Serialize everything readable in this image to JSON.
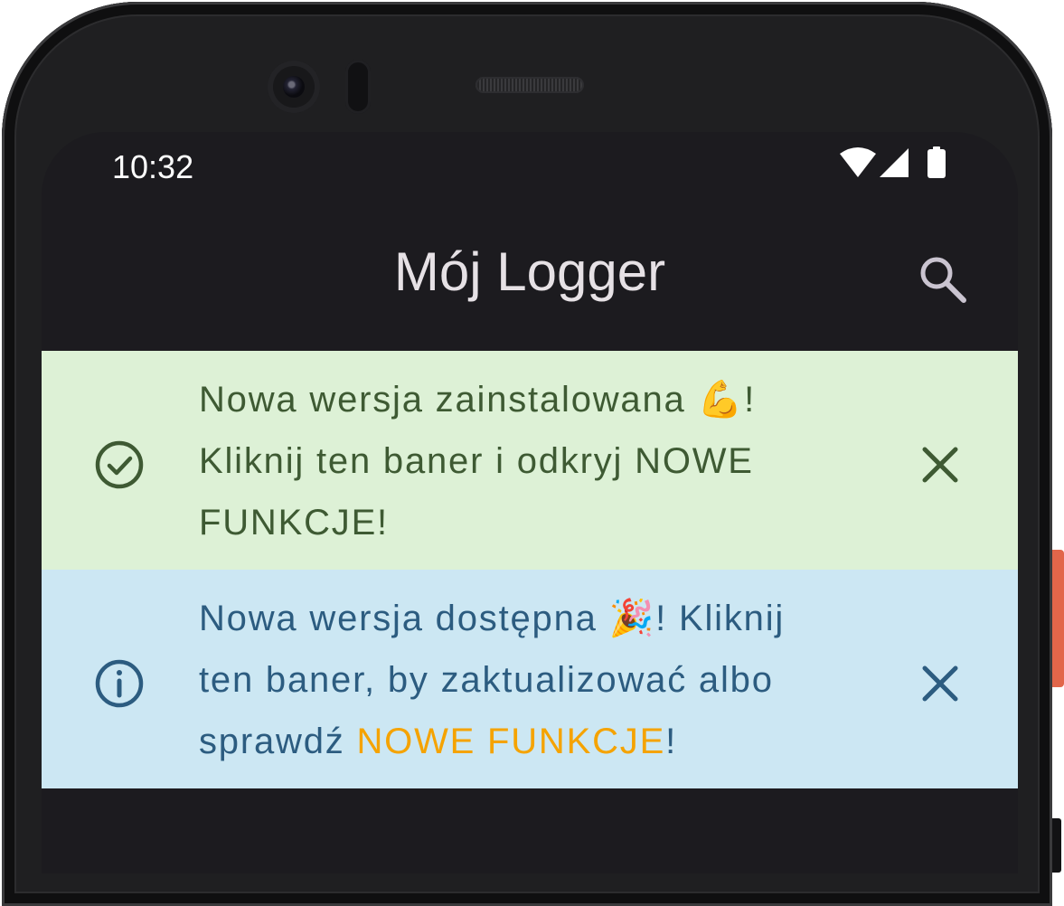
{
  "status_bar": {
    "time": "10:32"
  },
  "app_bar": {
    "title": "Mój Logger"
  },
  "banners": {
    "success": {
      "text": "Nowa wersja zainstalowana 💪! Kliknij ten baner i odkryj NOWE FUNKCJE!"
    },
    "info": {
      "text_before": "Nowa wersja dostępna 🎉! Kliknij ten baner, by zaktualizować albo sprawdź ",
      "text_highlight": "NOWE FUNKCJE",
      "text_after": "!"
    }
  },
  "icons": {
    "status": [
      "wifi-icon",
      "cell-signal-icon",
      "battery-icon"
    ],
    "app_bar": [
      "search-icon"
    ],
    "success_banner": [
      "check-circle-icon",
      "close-icon"
    ],
    "info_banner": [
      "info-icon",
      "close-icon"
    ]
  },
  "colors": {
    "screen_background": "#1c1b1f",
    "success_background": "#ddf1d6",
    "success_text": "#3e5a33",
    "info_background": "#cce7f3",
    "info_text": "#2c5c80",
    "highlight": "#f5a300"
  }
}
